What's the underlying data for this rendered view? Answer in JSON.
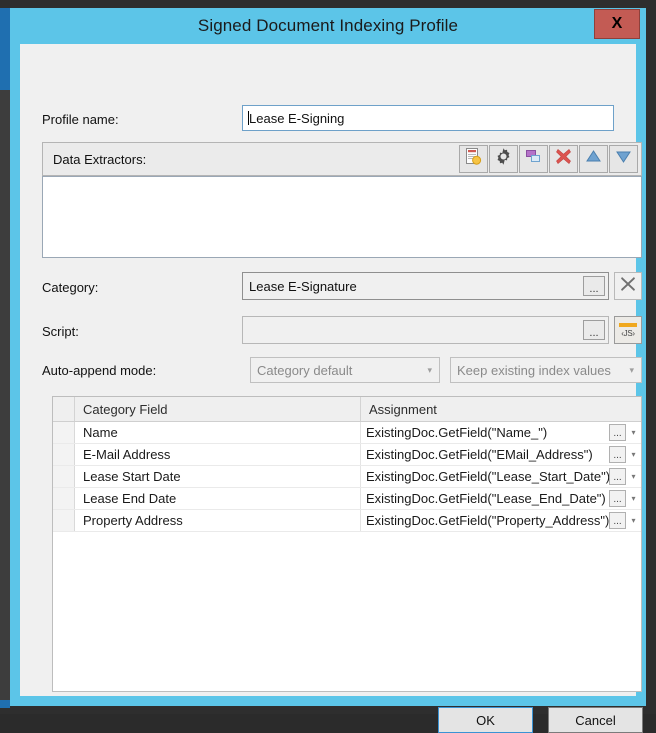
{
  "window": {
    "title": "Signed Document Indexing Profile",
    "close_label": "X",
    "accent": "#5cc5e8",
    "close_bg": "#c35b54"
  },
  "form": {
    "profile_name_label": "Profile name:",
    "profile_name_value": "Lease E-Signing",
    "extractors_label": "Data Extractors:",
    "extractors_items": [],
    "category_label": "Category:",
    "category_value": "Lease E-Signature",
    "script_label": "Script:",
    "script_value": "",
    "autoappend_label": "Auto-append mode:",
    "autoappend_mode_value": "Category default",
    "autoappend_keep_value": "Keep existing index values",
    "browse_label": "...",
    "js_label": "‹JS›"
  },
  "toolbar": {
    "buttons": [
      {
        "name": "new-extractor-icon",
        "tooltip": "New"
      },
      {
        "name": "settings-gear-icon",
        "tooltip": "Properties"
      },
      {
        "name": "copy-icon",
        "tooltip": "Copy"
      },
      {
        "name": "delete-x-icon",
        "tooltip": "Delete"
      },
      {
        "name": "move-up-icon",
        "tooltip": "Move Up"
      },
      {
        "name": "move-down-icon",
        "tooltip": "Move Down"
      }
    ]
  },
  "grid": {
    "columns": [
      "Category Field",
      "Assignment"
    ],
    "rows": [
      {
        "field": "Name",
        "assignment": "ExistingDoc.GetField(\"Name_\")"
      },
      {
        "field": "E-Mail Address",
        "assignment": "ExistingDoc.GetField(\"EMail_Address\")"
      },
      {
        "field": "Lease Start Date",
        "assignment": "ExistingDoc.GetField(\"Lease_Start_Date\")"
      },
      {
        "field": "Lease End Date",
        "assignment": "ExistingDoc.GetField(\"Lease_End_Date\")"
      },
      {
        "field": "Property Address",
        "assignment": "ExistingDoc.GetField(\"Property_Address\")"
      }
    ],
    "row_browse_label": "...",
    "row_dropdown_label": "▾"
  },
  "footer": {
    "ok_label": "OK",
    "cancel_label": "Cancel"
  }
}
